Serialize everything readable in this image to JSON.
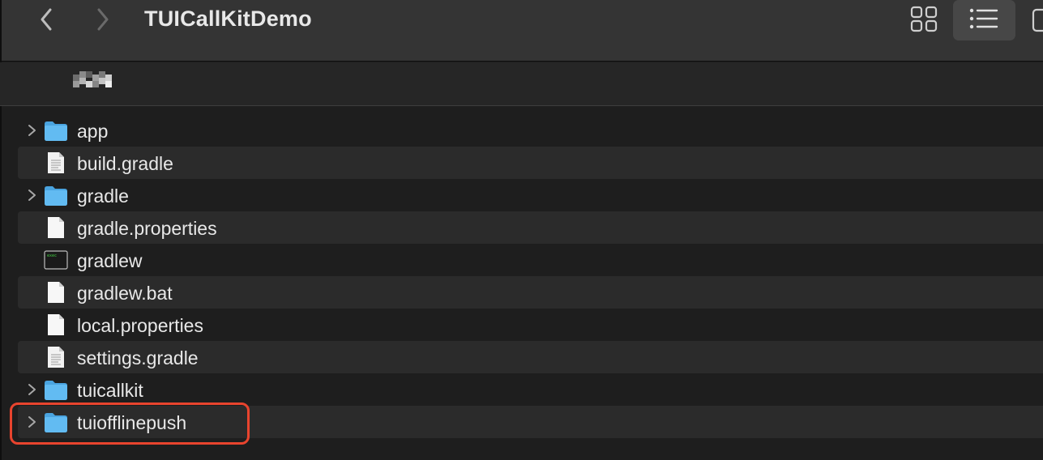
{
  "window": {
    "title": "TUICallKitDemo"
  },
  "toolbar": {
    "back_icon": "chevron-left-icon",
    "forward_icon": "chevron-right-icon",
    "grid_view_icon": "icon-grid-icon",
    "list_view_icon": "list-view-icon",
    "list_view_selected": true
  },
  "files": [
    {
      "name": "app",
      "kind": "folder",
      "expandable": true
    },
    {
      "name": "build.gradle",
      "kind": "document",
      "expandable": false
    },
    {
      "name": "gradle",
      "kind": "folder",
      "expandable": true
    },
    {
      "name": "gradle.properties",
      "kind": "blank-document",
      "expandable": false
    },
    {
      "name": "gradlew",
      "kind": "executable",
      "expandable": false
    },
    {
      "name": "gradlew.bat",
      "kind": "blank-document",
      "expandable": false
    },
    {
      "name": "local.properties",
      "kind": "blank-document",
      "expandable": false
    },
    {
      "name": "settings.gradle",
      "kind": "document",
      "expandable": false
    },
    {
      "name": "tuicallkit",
      "kind": "folder",
      "expandable": true
    },
    {
      "name": "tuiofflinepush",
      "kind": "folder",
      "expandable": true,
      "highlighted": true
    }
  ],
  "colors": {
    "folder": "#5fb6ee",
    "highlight": "#e8442e",
    "row_alt": "#2b2b2b"
  }
}
